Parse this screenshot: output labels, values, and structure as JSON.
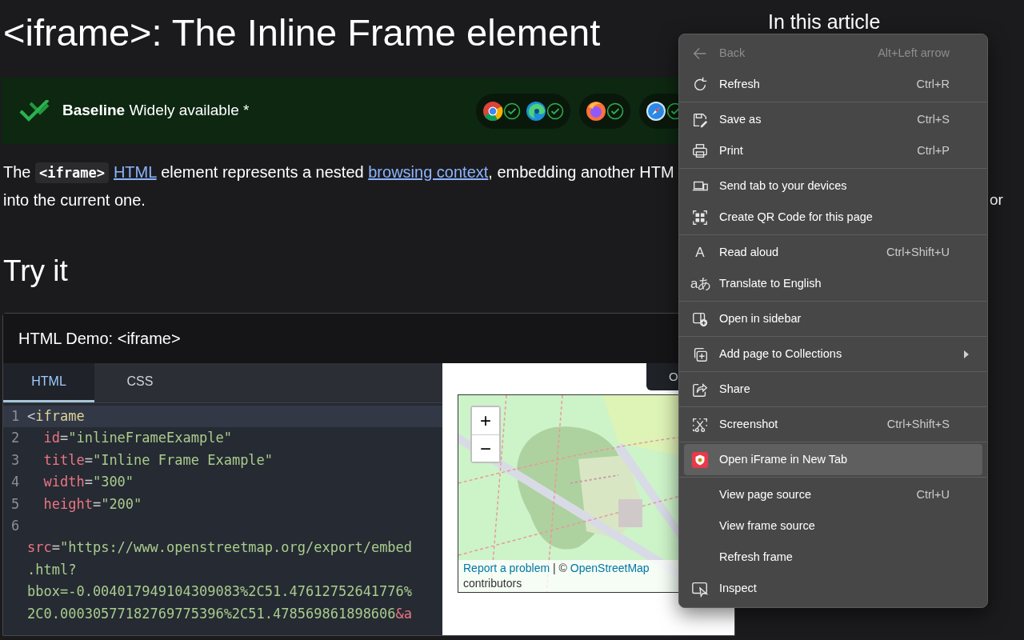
{
  "title": "<iframe>: The Inline Frame element",
  "baseline": {
    "text": "**Baseline** Widely available *",
    "groups": [
      {
        "browsers": [
          {
            "kind": "chrome",
            "supported": true
          },
          {
            "kind": "edge",
            "supported": true
          }
        ]
      },
      {
        "browsers": [
          {
            "kind": "firefox",
            "supported": true
          }
        ]
      },
      {
        "browsers": [
          {
            "kind": "safari",
            "supported": true
          }
        ]
      }
    ]
  },
  "description": [
    {
      "kind": "text",
      "text": "The "
    },
    {
      "kind": "code",
      "text": "<iframe>"
    },
    {
      "kind": "link",
      "text": "HTML"
    },
    {
      "kind": "text",
      "text": " element represents a nested "
    },
    {
      "kind": "link",
      "text": "browsing context"
    },
    {
      "kind": "text",
      "text": ", embedding another HTM"
    },
    {
      "kind": "break"
    },
    {
      "kind": "text",
      "text": "into the current one."
    }
  ],
  "section_heading": "Try it",
  "demo": {
    "title": "HTML Demo: <iframe>",
    "tabs": [
      {
        "label": "HTML",
        "selected": true
      },
      {
        "label": "CSS",
        "selected": false
      }
    ],
    "lines": [
      {
        "number": "1",
        "active": true,
        "rows": [
          {
            "tokens": [
              {
                "kind": "punct",
                "text": "<"
              },
              {
                "kind": "tag",
                "text": "iframe"
              }
            ]
          }
        ]
      },
      {
        "number": "2",
        "active": false,
        "rows": [
          {
            "indented": true,
            "tokens": [
              {
                "kind": "attr",
                "text": "id"
              },
              {
                "kind": "punct",
                "text": "="
              },
              {
                "kind": "str",
                "text": "\"inlineFrameExample\""
              }
            ]
          }
        ]
      },
      {
        "number": "3",
        "active": false,
        "rows": [
          {
            "indented": true,
            "tokens": [
              {
                "kind": "attr",
                "text": "title"
              },
              {
                "kind": "punct",
                "text": "="
              },
              {
                "kind": "str",
                "text": "\"Inline Frame Example\""
              }
            ]
          }
        ]
      },
      {
        "number": "4",
        "active": false,
        "rows": [
          {
            "indented": true,
            "tokens": [
              {
                "kind": "attr",
                "text": "width"
              },
              {
                "kind": "punct",
                "text": "="
              },
              {
                "kind": "str",
                "text": "\"300\""
              }
            ]
          }
        ]
      },
      {
        "number": "5",
        "active": false,
        "rows": [
          {
            "indented": true,
            "tokens": [
              {
                "kind": "attr",
                "text": "height"
              },
              {
                "kind": "punct",
                "text": "="
              },
              {
                "kind": "str",
                "text": "\"200\""
              }
            ]
          }
        ]
      },
      {
        "number": "6",
        "active": false,
        "rows": [
          {
            "tokens": [
              {
                "kind": "attr",
                "text": "src"
              },
              {
                "kind": "punct",
                "text": "="
              },
              {
                "kind": "str",
                "text": "\"https://www.openstreetmap.org/export/embed"
              }
            ]
          },
          {
            "tokens": [
              {
                "kind": "str",
                "text": ".html?"
              }
            ]
          },
          {
            "tokens": [
              {
                "kind": "str",
                "text": "bbox=-0.004017949104309083%2C51.47612752641776%"
              }
            ]
          },
          {
            "tokens": [
              {
                "kind": "str",
                "text": "2C0.00030577182769775396%2C51.478569861898606"
              },
              {
                "kind": "entity",
                "text": "&a"
              }
            ]
          }
        ]
      }
    ],
    "output_button": "O",
    "map": {
      "zoom_in": "+",
      "zoom_out": "−",
      "report_link": "Report a problem",
      "separator": " | © ",
      "osm_link": "OpenStreetMap",
      "contributors": "contributors"
    }
  },
  "sidebar": {
    "heading": "In this article",
    "fragment": "or"
  },
  "context_menu": {
    "groups": [
      {
        "items": [
          {
            "kind": "back",
            "label": "Back",
            "shortcut": "Alt+Left arrow",
            "disabled": true,
            "highlighted": false
          },
          {
            "kind": "refresh",
            "label": "Refresh",
            "shortcut": "Ctrl+R",
            "disabled": false,
            "highlighted": false
          }
        ]
      },
      {
        "items": [
          {
            "kind": "save",
            "label": "Save as",
            "shortcut": "Ctrl+S",
            "disabled": false,
            "highlighted": false
          },
          {
            "kind": "print",
            "label": "Print",
            "shortcut": "Ctrl+P",
            "disabled": false,
            "highlighted": false
          }
        ]
      },
      {
        "items": [
          {
            "kind": "devices",
            "label": "Send tab to your devices",
            "disabled": false,
            "highlighted": false
          },
          {
            "kind": "qr",
            "label": "Create QR Code for this page",
            "disabled": false,
            "highlighted": false
          }
        ]
      },
      {
        "items": [
          {
            "kind": "char",
            "icon_text": "A",
            "label": "Read aloud",
            "shortcut": "Ctrl+Shift+U",
            "disabled": false,
            "highlighted": false
          },
          {
            "kind": "char",
            "icon_text": "aあ",
            "label": "Translate to English",
            "disabled": false,
            "highlighted": false
          }
        ]
      },
      {
        "items": [
          {
            "kind": "sidebar",
            "label": "Open in sidebar",
            "disabled": false,
            "highlighted": false
          }
        ]
      },
      {
        "items": [
          {
            "kind": "collections",
            "label": "Add page to Collections",
            "submenu": true,
            "disabled": false,
            "highlighted": false
          }
        ]
      },
      {
        "items": [
          {
            "kind": "share",
            "label": "Share",
            "disabled": false,
            "highlighted": false
          }
        ]
      },
      {
        "items": [
          {
            "kind": "screenshot",
            "label": "Screenshot",
            "shortcut": "Ctrl+Shift+S",
            "disabled": false,
            "highlighted": false
          }
        ]
      },
      {
        "items": [
          {
            "kind": "extension",
            "label": "Open iFrame in New Tab",
            "disabled": false,
            "highlighted": true
          }
        ]
      },
      {
        "items": [
          {
            "kind": "plain",
            "label": "View page source",
            "shortcut": "Ctrl+U",
            "disabled": false,
            "highlighted": false
          },
          {
            "kind": "plain",
            "label": "View frame source",
            "disabled": false,
            "highlighted": false
          },
          {
            "kind": "plain",
            "label": "Refresh frame",
            "disabled": false,
            "highlighted": false
          },
          {
            "kind": "inspect",
            "label": "Inspect",
            "disabled": false,
            "highlighted": false
          }
        ]
      }
    ]
  }
}
